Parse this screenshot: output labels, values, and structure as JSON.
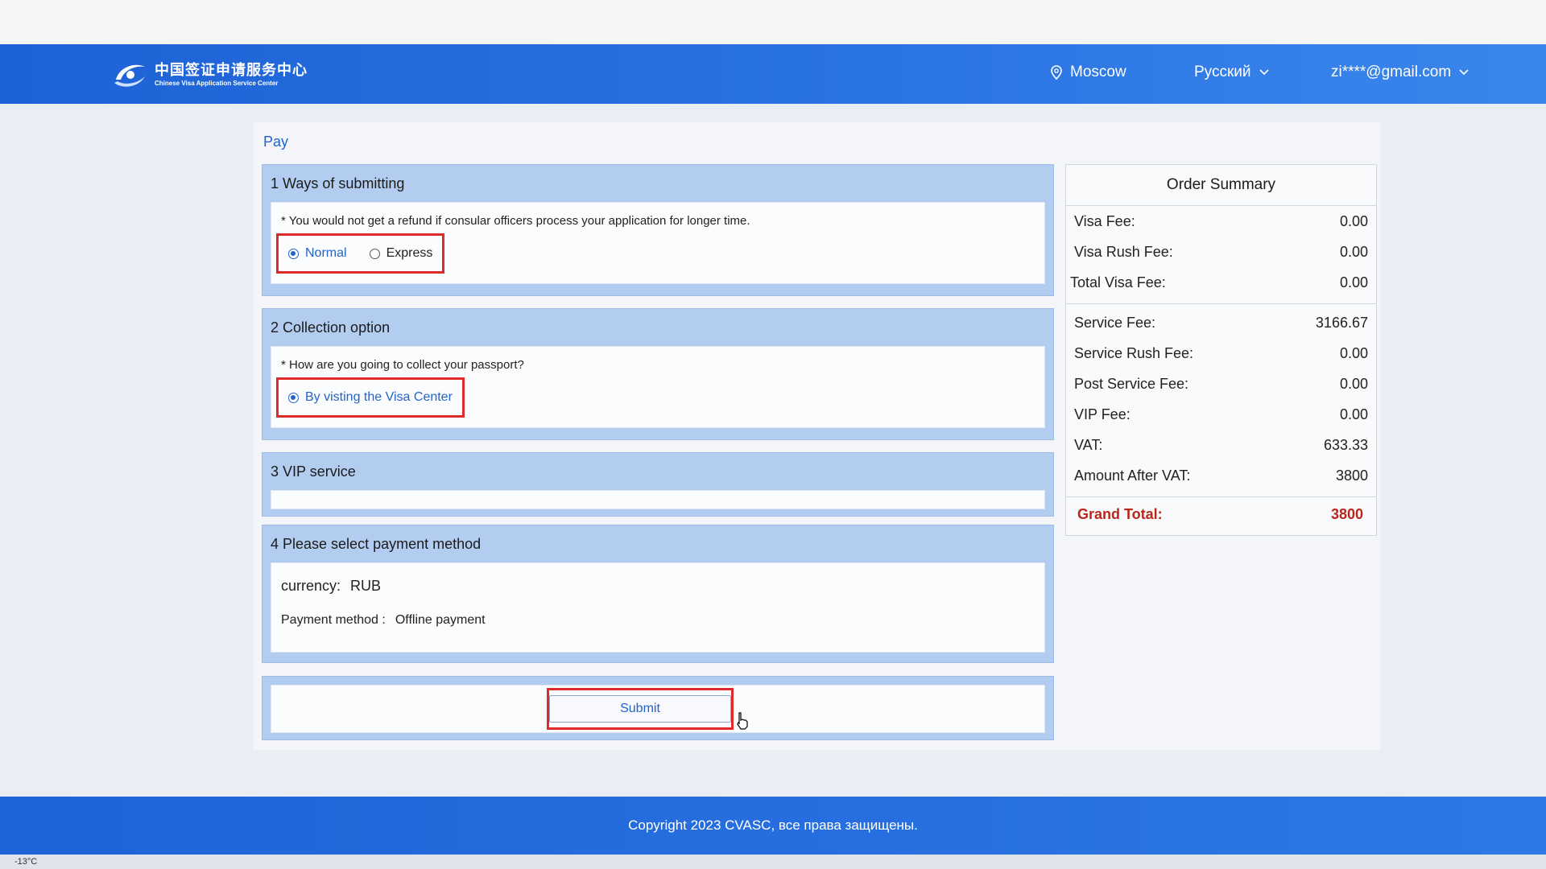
{
  "header": {
    "logo_cn": "中国签证申请服务中心",
    "logo_en": "Chinese Visa Application Service Center",
    "city": "Moscow",
    "language": "Русский",
    "user_email": "zi****@gmail.com"
  },
  "breadcrumb": "Pay",
  "sections": {
    "submitting": {
      "title": "1 Ways of submitting",
      "note": "* You would not get a refund if consular officers process your application for longer time.",
      "options": [
        "Normal",
        "Express"
      ],
      "selected": "Normal"
    },
    "collection": {
      "title": "2 Collection option",
      "note": "* How are you going to collect your passport?",
      "options": [
        "By visting the Visa Center"
      ],
      "selected": "By visting the Visa Center"
    },
    "vip": {
      "title": "3 VIP service"
    },
    "payment": {
      "title": "4 Please select payment method",
      "currency_label": "currency:",
      "currency_value": "RUB",
      "method_label": "Payment method :",
      "method_value": "Offline payment"
    },
    "submit_label": "Submit"
  },
  "order_summary": {
    "title": "Order Summary",
    "visa_fee": {
      "label": "Visa Fee:",
      "value": "0.00"
    },
    "visa_rush_fee": {
      "label": "Visa Rush Fee:",
      "value": "0.00"
    },
    "total_visa_fee": {
      "label": "Total Visa Fee:",
      "value": "0.00"
    },
    "service_fee": {
      "label": "Service Fee:",
      "value": "3166.67"
    },
    "service_rush_fee": {
      "label": "Service Rush Fee:",
      "value": "0.00"
    },
    "post_service_fee": {
      "label": "Post Service Fee:",
      "value": "0.00"
    },
    "vip_fee": {
      "label": "VIP Fee:",
      "value": "0.00"
    },
    "vat": {
      "label": "VAT:",
      "value": "633.33"
    },
    "amount_after_vat": {
      "label": "Amount After VAT:",
      "value": "3800"
    },
    "grand_total": {
      "label": "Grand Total:",
      "value": "3800"
    }
  },
  "footer": "Copyright 2023 CVASC, все права защищены.",
  "taskbar": {
    "weather": "-13°C"
  },
  "colors": {
    "primary": "#2463c9",
    "header": "#1d62d6",
    "highlight": "#e02a2a",
    "grand_total": "#b8261c"
  }
}
